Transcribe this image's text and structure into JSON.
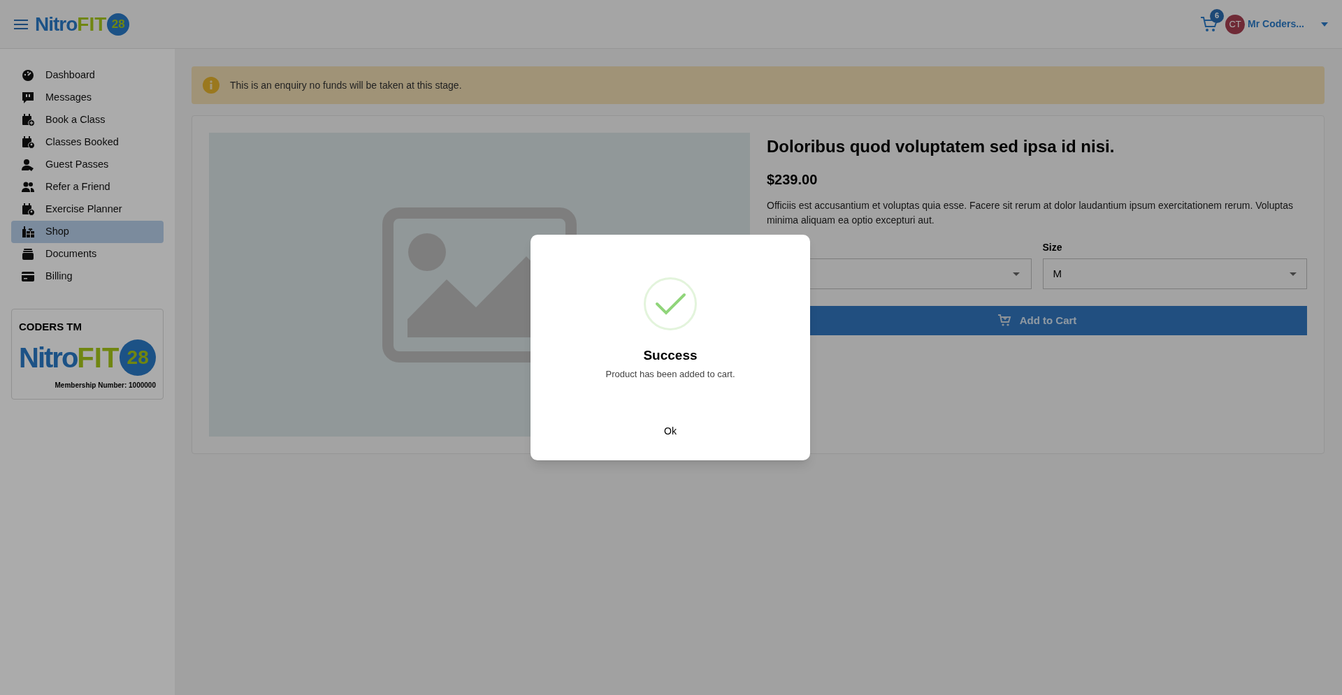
{
  "header": {
    "logo": {
      "word": "Nitro",
      "accent": "FIT",
      "badge": "28"
    },
    "cart_count": "6",
    "avatar_initials": "CT",
    "user_name": "Mr Coders..."
  },
  "sidebar": {
    "items": [
      {
        "label": "Dashboard",
        "kind": "gauge",
        "selected": false
      },
      {
        "label": "Messages",
        "kind": "chat",
        "selected": false
      },
      {
        "label": "Book a Class",
        "kind": "calendar-plus",
        "selected": false
      },
      {
        "label": "Classes Booked",
        "kind": "calendar-user",
        "selected": false
      },
      {
        "label": "Guest Passes",
        "kind": "user-tag",
        "selected": false
      },
      {
        "label": "Refer a Friend",
        "kind": "users",
        "selected": false
      },
      {
        "label": "Exercise Planner",
        "kind": "calendar-user",
        "selected": false
      },
      {
        "label": "Shop",
        "kind": "gift",
        "selected": true
      },
      {
        "label": "Documents",
        "kind": "box",
        "selected": false
      },
      {
        "label": "Billing",
        "kind": "card",
        "selected": false
      }
    ]
  },
  "member_card": {
    "name": "CODERS TM",
    "logo": {
      "word": "Nitro",
      "accent": "FIT",
      "badge": "28"
    },
    "membership": "Membership Number: 1000000"
  },
  "alert": {
    "text": "This is an enquiry no funds will be taken at this stage."
  },
  "product": {
    "title": "Doloribus quod voluptatem sed ipsa id nisi.",
    "price": "$239.00",
    "description": "Officiis est accusantium et voluptas quia esse. Facere sit rerum at dolor laudantium ipsum exercitationem rerum. Voluptas minima aliquam ea optio excepturi aut.",
    "size_label": "Size",
    "size_value": "M",
    "button": "Add to Cart"
  },
  "dialog": {
    "title": "Success",
    "message": "Product has been added to cart.",
    "button": "Ok"
  }
}
